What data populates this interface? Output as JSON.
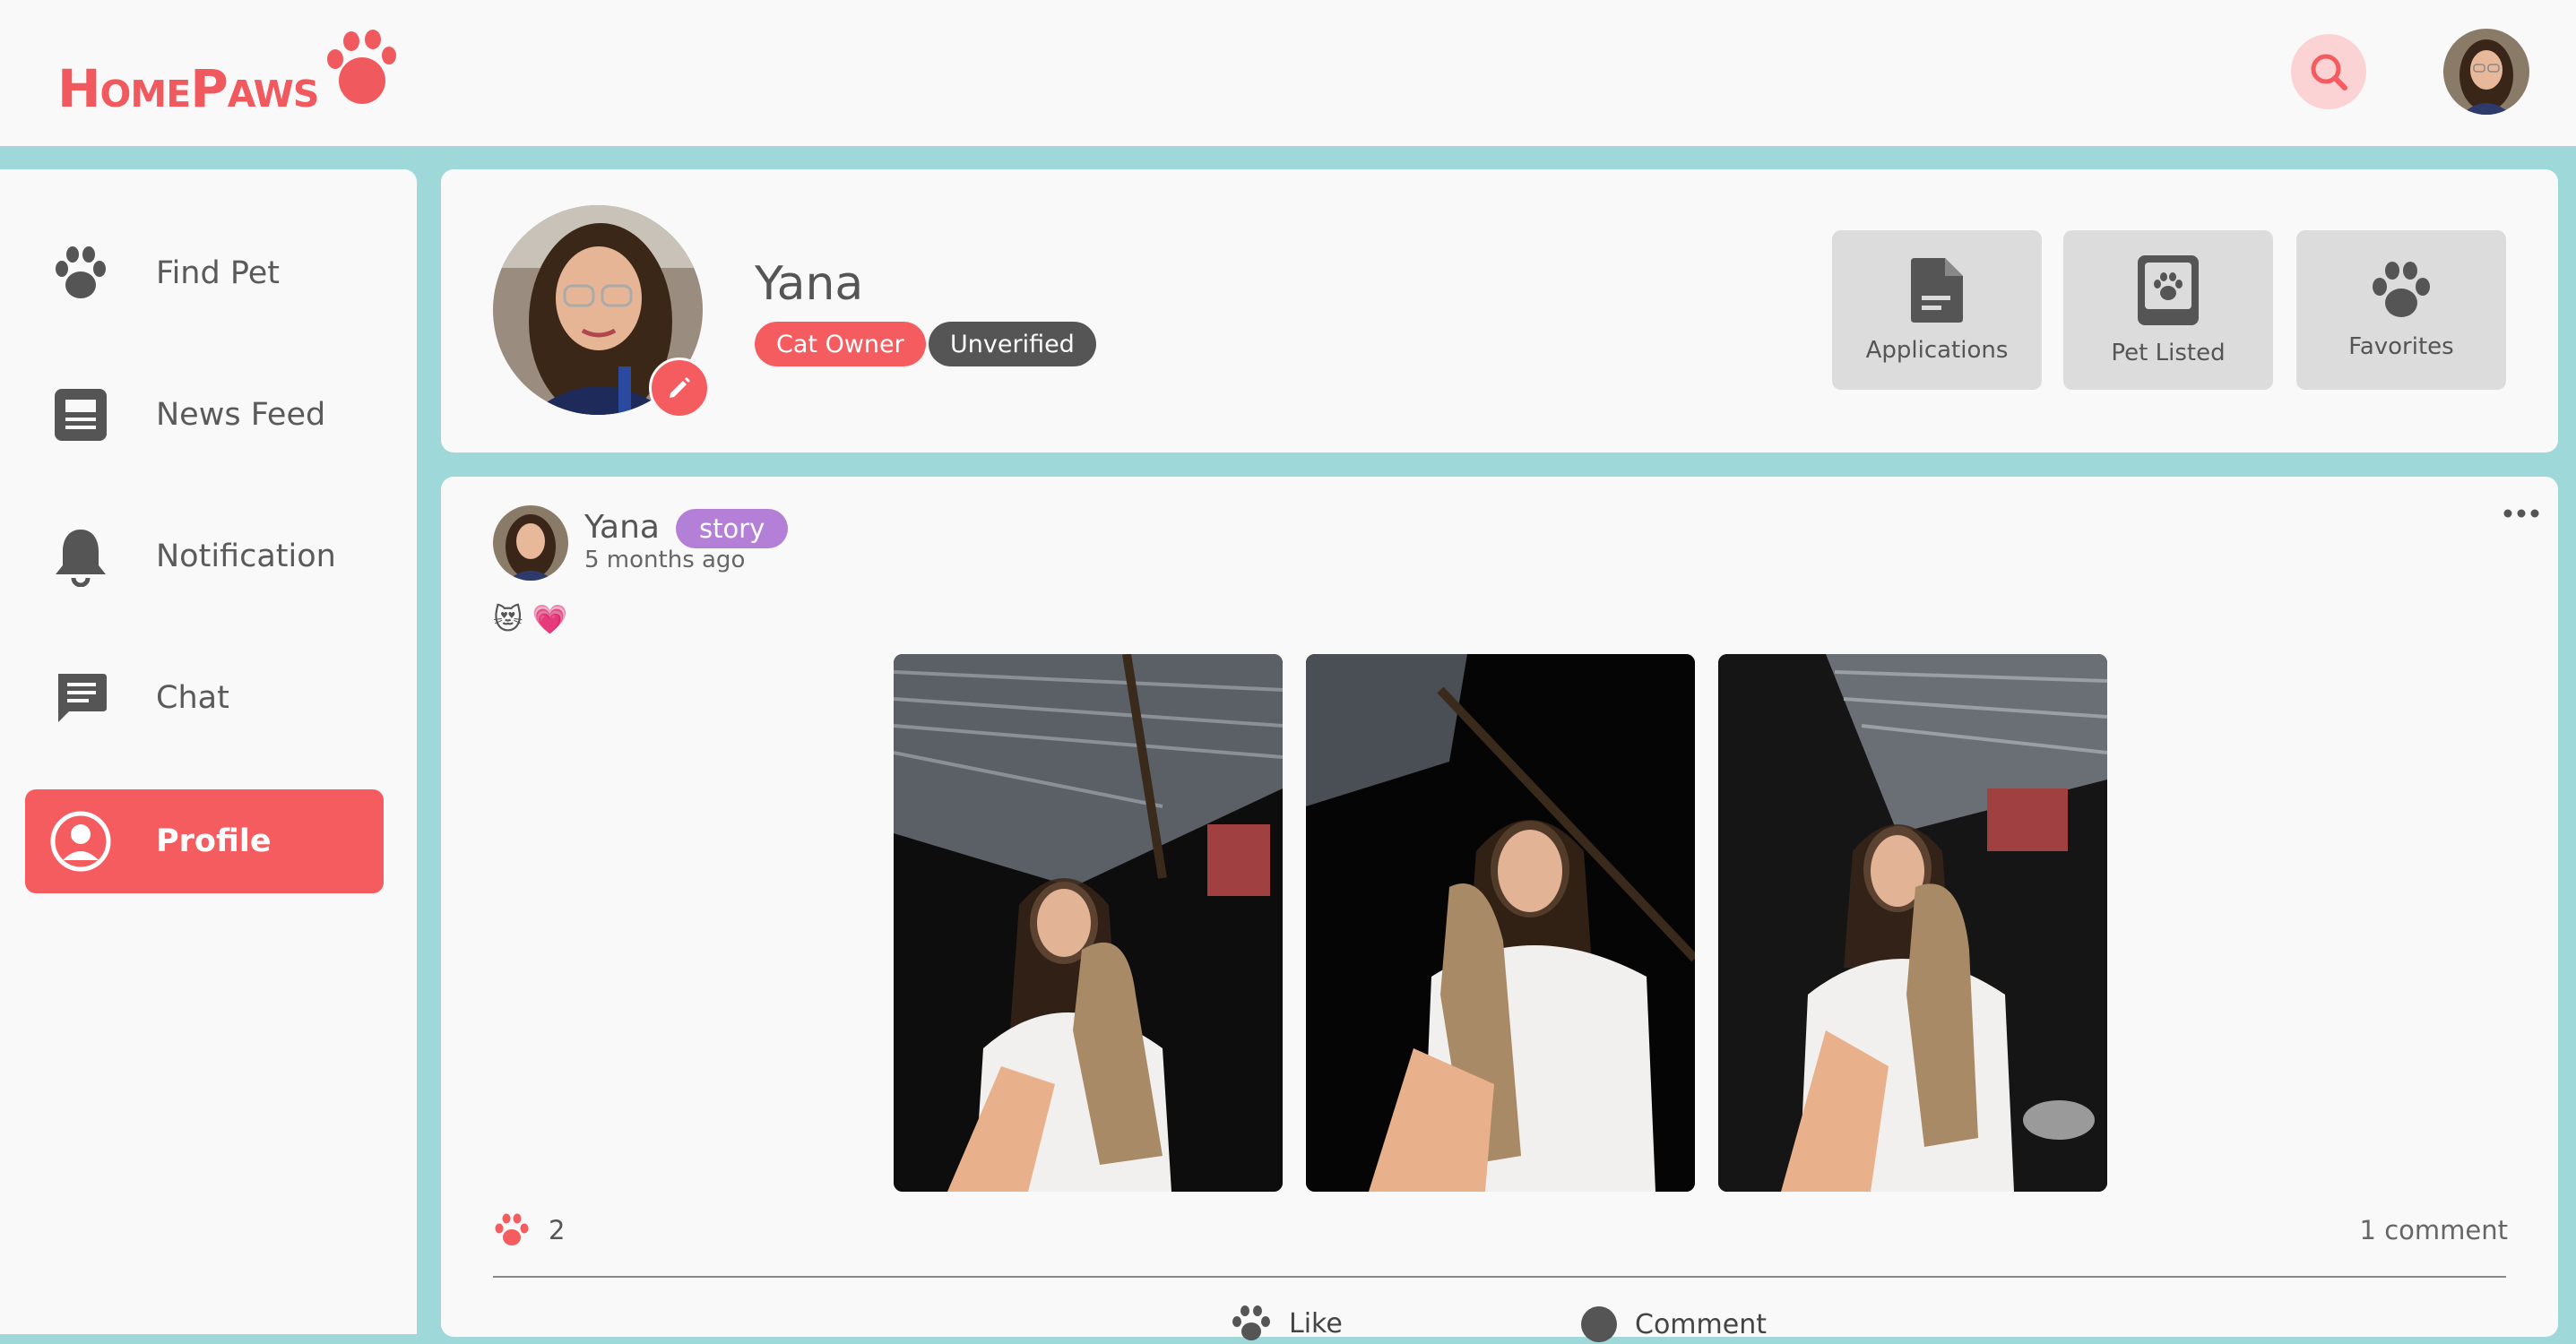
{
  "app": {
    "logo_text": "HomePaws",
    "brand_color": "#f45c60",
    "background_color": "#9fd8d8"
  },
  "header": {
    "search_icon": "search-icon",
    "avatar_icon": "user-avatar"
  },
  "sidebar": {
    "items": [
      {
        "label": "Find Pet",
        "icon": "paw-icon"
      },
      {
        "label": "News Feed",
        "icon": "newspaper-icon"
      },
      {
        "label": "Notification",
        "icon": "bell-icon"
      },
      {
        "label": "Chat",
        "icon": "chat-icon"
      },
      {
        "label": "Profile",
        "icon": "user-circle-icon",
        "active": true
      }
    ]
  },
  "profile": {
    "name": "Yana",
    "role_badge": "Cat Owner",
    "status_badge": "Unverified",
    "stats": [
      {
        "label": "Applications",
        "icon": "document-icon"
      },
      {
        "label": "Pet Listed",
        "icon": "pet-list-icon"
      },
      {
        "label": "Favorites",
        "icon": "paw-icon"
      }
    ]
  },
  "post": {
    "author": "Yana",
    "tag": "story",
    "time": "5 months ago",
    "text": "😻 💗",
    "photo_count": 3,
    "reaction_count": "2",
    "comment_count": "1 comment",
    "actions": [
      {
        "label": "Like",
        "icon": "paw-icon"
      },
      {
        "label": "Comment",
        "icon": "comment-icon"
      }
    ]
  }
}
